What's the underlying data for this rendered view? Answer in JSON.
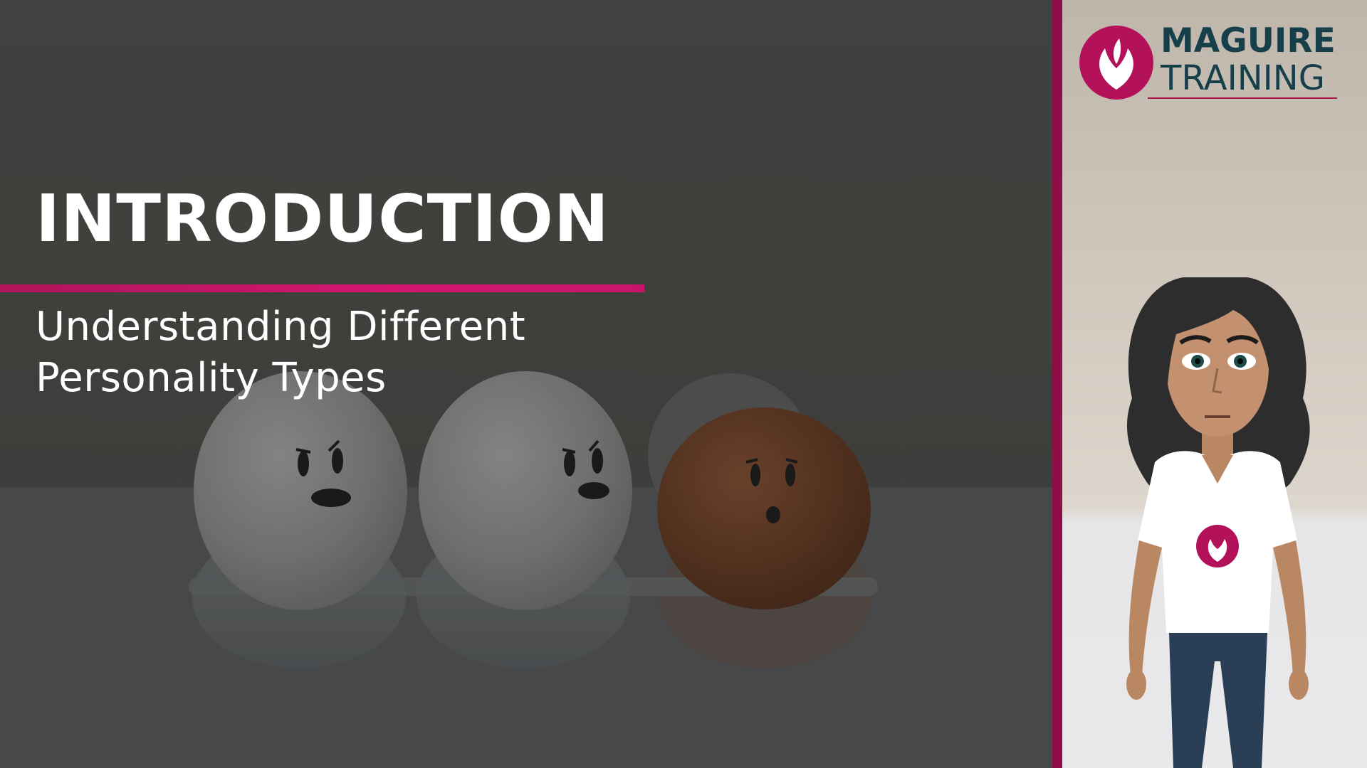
{
  "slide": {
    "title": "INTRODUCTION",
    "subtitle_lines": [
      "Understanding Different",
      "Personality Types"
    ]
  },
  "brand": {
    "name_line1": "MAGUIRE",
    "name_line2": "TRAINING",
    "accent_color": "#c8156a",
    "text_color": "#173f4a"
  },
  "background_image": {
    "icon": "eggs-photo"
  },
  "presenter": {
    "icon": "presenter-avatar"
  }
}
